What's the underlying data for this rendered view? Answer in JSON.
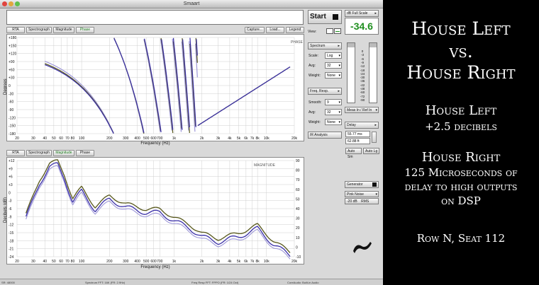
{
  "window": {
    "title": "Smaart"
  },
  "toolbar": {
    "start_label": "Start",
    "db_full_scale_label": "dB Full Scale",
    "level_value": "-34.6",
    "view_label": "View:"
  },
  "upper_tabs": [
    "RTA",
    "Spectrograph",
    "Magnitude",
    "Phase"
  ],
  "upper_selected": "Phase",
  "upper_actions": [
    "Capture...",
    "Load...",
    "Legend"
  ],
  "lower_tabs": [
    "RTA",
    "Spectrograph",
    "Magnitude",
    "Phase"
  ],
  "lower_selected": "Magnitude",
  "lower_actions": [
    "Capture...",
    "Load...",
    "Legend"
  ],
  "phase_plot": {
    "plot_name": "PHASE",
    "ylabel": "Degrees",
    "xlabel": "Frequency (Hz)",
    "y_ticks": [
      "+180",
      "+150",
      "+120",
      "+90",
      "+60",
      "+30",
      "0",
      "-30",
      "-60",
      "-90",
      "-120",
      "-150",
      "-180"
    ],
    "x_ticks": [
      "20",
      "30",
      "40",
      "50",
      "60",
      "70",
      "80",
      "100",
      "200",
      "300",
      "400",
      "500",
      "600",
      "700",
      "1k",
      "2k",
      "3k",
      "4k",
      "5k",
      "6k",
      "7k",
      "8k",
      "10k",
      "20k"
    ]
  },
  "magnitude_plot": {
    "plot_name": "MAGNITUDE",
    "ylabel": "Decibels (dB)",
    "xlabel": "Frequency (Hz)",
    "y_ticks": [
      "+12",
      "+9",
      "+6",
      "+3",
      "0",
      "-3",
      "-6",
      "-9",
      "-12",
      "-15",
      "-18",
      "-21",
      "-24"
    ],
    "y2_ticks": [
      "90",
      "80",
      "70",
      "60",
      "50",
      "40",
      "30",
      "20",
      "10",
      "0",
      "-10"
    ],
    "x_ticks": [
      "20",
      "30",
      "40",
      "50",
      "60",
      "70",
      "80",
      "100",
      "200",
      "300",
      "400",
      "500",
      "600",
      "700",
      "1k",
      "2k",
      "3k",
      "4k",
      "5k",
      "6k",
      "7k",
      "8k",
      "10k",
      "20k"
    ]
  },
  "spectrum_panel": {
    "title": "Spectrum",
    "scale_label": "Scale:",
    "scale_value": "Log",
    "avg_label": "Avg:",
    "avg_value": "32",
    "weight_label": "Weight:",
    "weight_value": "None"
  },
  "freq_panel": {
    "title": "Freq. Resp.",
    "smooth_label": "Smooth:",
    "smooth_value": "9",
    "avg_label": "Avg:",
    "avg_value": "32",
    "weight_label": "Weight:",
    "weight_value": "None"
  },
  "ir_analysis_label": "IR Analysis",
  "meter_scale": [
    "0",
    "-3",
    "-6",
    "-9",
    "-12",
    "-18",
    "-24",
    "-30",
    "-36",
    "-42",
    "-48",
    "-60",
    "-72",
    "-90"
  ],
  "meas_ref_label": "Meas In / Ref In",
  "delay_panel": {
    "title": "Delay",
    "ms_value": "55.77 ms",
    "ft_value": "62.88 ft",
    "auto_sm_label": "Auto Sm",
    "auto_lg_label": "Auto Lg"
  },
  "generator_panel": {
    "title": "Generator",
    "signal_value": "Pink Noise",
    "level_value": "-20 dB",
    "level_unit": "RMS"
  },
  "status_bar": {
    "sample_rate": "SR: 48000",
    "spectrum": "Spectrum FFT: 16K (FR: 2.9Hz)",
    "freq_resp": "Freq Resp FFT: FPPO (FR: 1/24 Oct)",
    "device": "CoreAudio: Built-in Audio"
  },
  "slide": {
    "title_line1": "House Left",
    "title_line2": "vs.",
    "title_line3": "House Right",
    "hl_heading": "House Left",
    "hl_detail": "+2.5 decibels",
    "hr_heading": "House Right",
    "hr_detail_1": "125 Microseconds of",
    "hr_detail_2": "delay to high outputs",
    "hr_detail_3": "on DSP",
    "footer": "Row N, Seat 112"
  },
  "colors": {
    "trace_house_left": "#57571a",
    "trace_house_right": "#3a2fa8",
    "trace_light": "#9d97d8",
    "level_readout": "#1f8f1f"
  }
}
